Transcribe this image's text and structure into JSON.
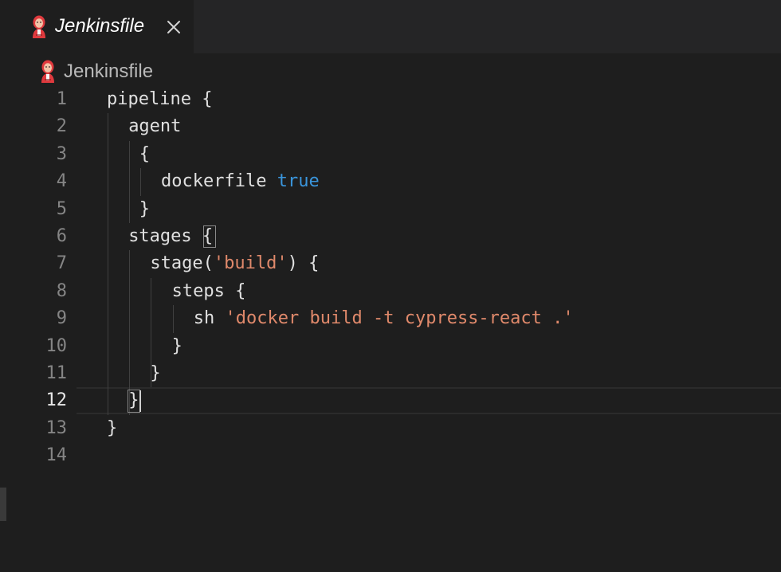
{
  "tab": {
    "title": "Jenkinsfile",
    "icon": "jenkins-icon",
    "close_icon": "close-icon"
  },
  "breadcrumb": {
    "label": "Jenkinsfile",
    "icon": "jenkins-icon"
  },
  "editor": {
    "active_line": 12,
    "lines": [
      {
        "number": "1",
        "indent": 0,
        "tokens": [
          {
            "text": "pipeline {",
            "type": "plain"
          }
        ]
      },
      {
        "number": "2",
        "indent": 2,
        "tokens": [
          {
            "text": "agent",
            "type": "plain"
          }
        ]
      },
      {
        "number": "3",
        "indent": 3,
        "tokens": [
          {
            "text": "{",
            "type": "plain"
          }
        ]
      },
      {
        "number": "4",
        "indent": 5,
        "tokens": [
          {
            "text": "dockerfile ",
            "type": "plain"
          },
          {
            "text": "true",
            "type": "keyword"
          }
        ]
      },
      {
        "number": "5",
        "indent": 3,
        "tokens": [
          {
            "text": "}",
            "type": "plain"
          }
        ]
      },
      {
        "number": "6",
        "indent": 2,
        "tokens": [
          {
            "text": "stages ",
            "type": "plain"
          },
          {
            "text": "{",
            "type": "plain"
          }
        ]
      },
      {
        "number": "7",
        "indent": 4,
        "tokens": [
          {
            "text": "stage(",
            "type": "plain"
          },
          {
            "text": "'build'",
            "type": "string"
          },
          {
            "text": ") {",
            "type": "plain"
          }
        ]
      },
      {
        "number": "8",
        "indent": 6,
        "tokens": [
          {
            "text": "steps {",
            "type": "plain"
          }
        ]
      },
      {
        "number": "9",
        "indent": 8,
        "tokens": [
          {
            "text": "sh ",
            "type": "plain"
          },
          {
            "text": "'docker build -t cypress-react .'",
            "type": "string"
          }
        ]
      },
      {
        "number": "10",
        "indent": 6,
        "tokens": [
          {
            "text": "}",
            "type": "plain"
          }
        ]
      },
      {
        "number": "11",
        "indent": 4,
        "tokens": [
          {
            "text": "}",
            "type": "plain"
          }
        ]
      },
      {
        "number": "12",
        "indent": 2,
        "tokens": [
          {
            "text": "}",
            "type": "plain"
          }
        ]
      },
      {
        "number": "13",
        "indent": 0,
        "tokens": [
          {
            "text": "}",
            "type": "plain"
          }
        ]
      },
      {
        "number": "14",
        "indent": 0,
        "tokens": []
      }
    ]
  }
}
